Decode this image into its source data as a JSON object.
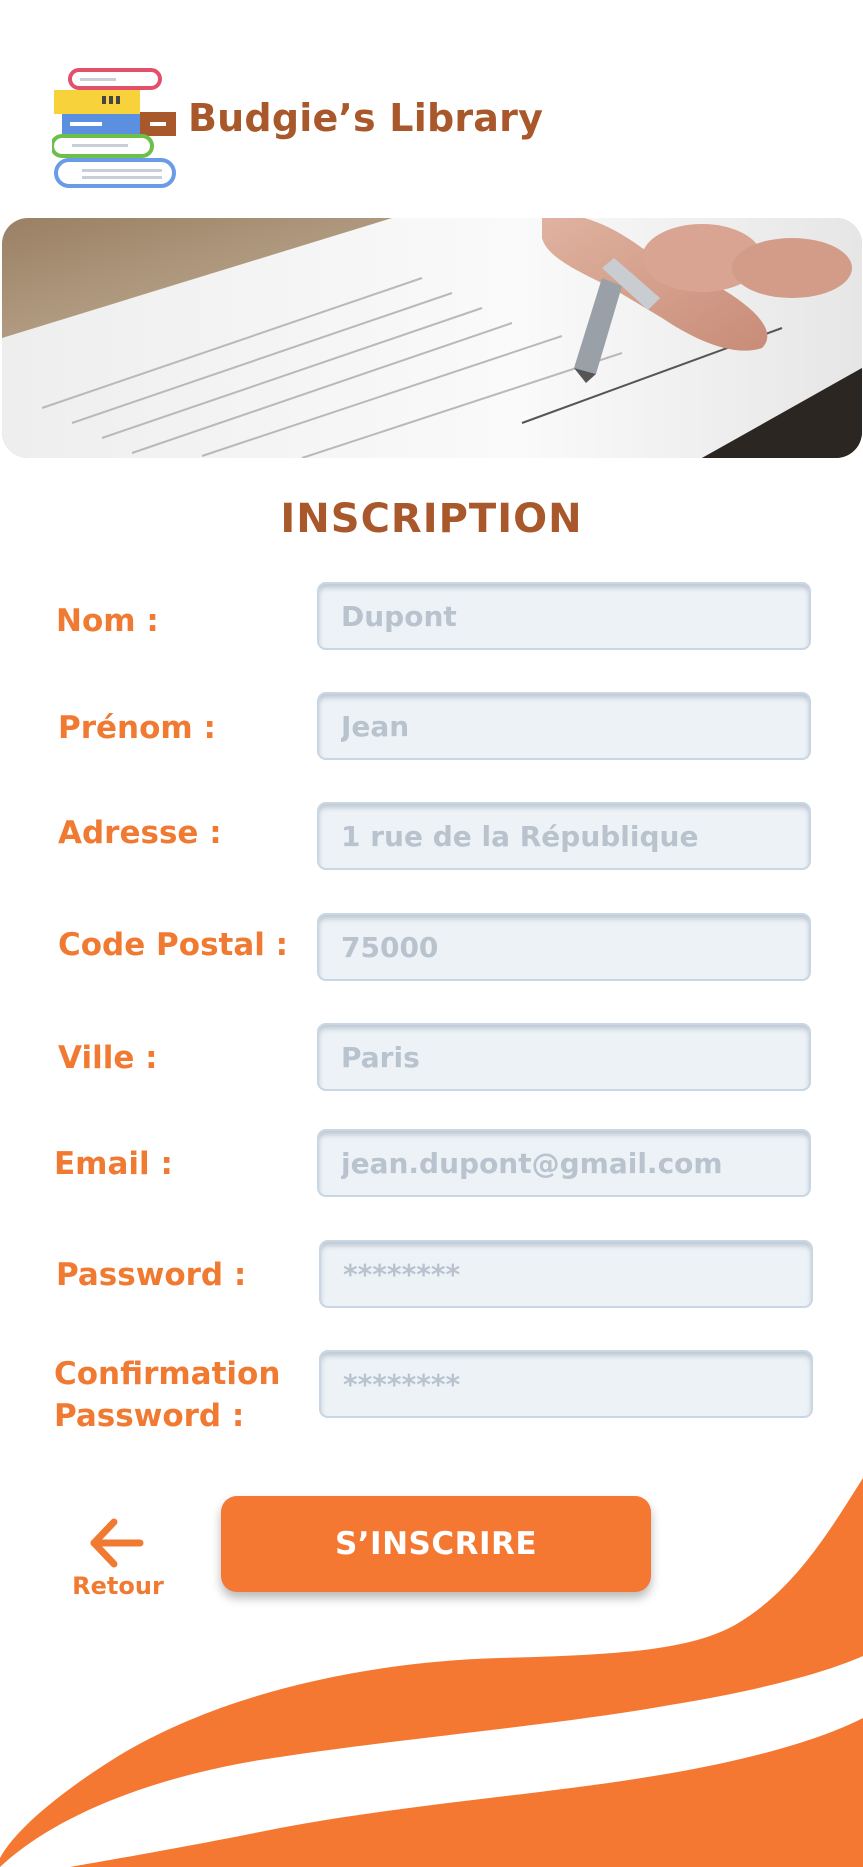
{
  "app": {
    "title": "Budgie’s Library",
    "logo_icon": "stacked-books-icon"
  },
  "hero": {
    "image": "hand-signing-document-photo"
  },
  "form": {
    "title": "INSCRIPTION",
    "fields": [
      {
        "label": "Nom :",
        "placeholder": "Dupont"
      },
      {
        "label": "Prénom :",
        "placeholder": "Jean"
      },
      {
        "label": "Adresse :",
        "placeholder": "1 rue de la République"
      },
      {
        "label": "Code Postal :",
        "placeholder": "75000"
      },
      {
        "label": "Ville :",
        "placeholder": "Paris"
      },
      {
        "label": "Email :",
        "placeholder": "jean.dupont@gmail.com"
      },
      {
        "label": "Password :",
        "placeholder": "********"
      },
      {
        "label_line1": "Confirmation",
        "label_line2": "Password :",
        "placeholder": "********"
      }
    ],
    "submit_label": "S’INSCRIRE"
  },
  "nav": {
    "back_label": "Retour",
    "back_icon": "arrow-left-icon"
  },
  "colors": {
    "accent": "#f47832",
    "title": "#a8582a",
    "field_bg": "#edf2f7",
    "field_text": "#b8c3ce"
  }
}
